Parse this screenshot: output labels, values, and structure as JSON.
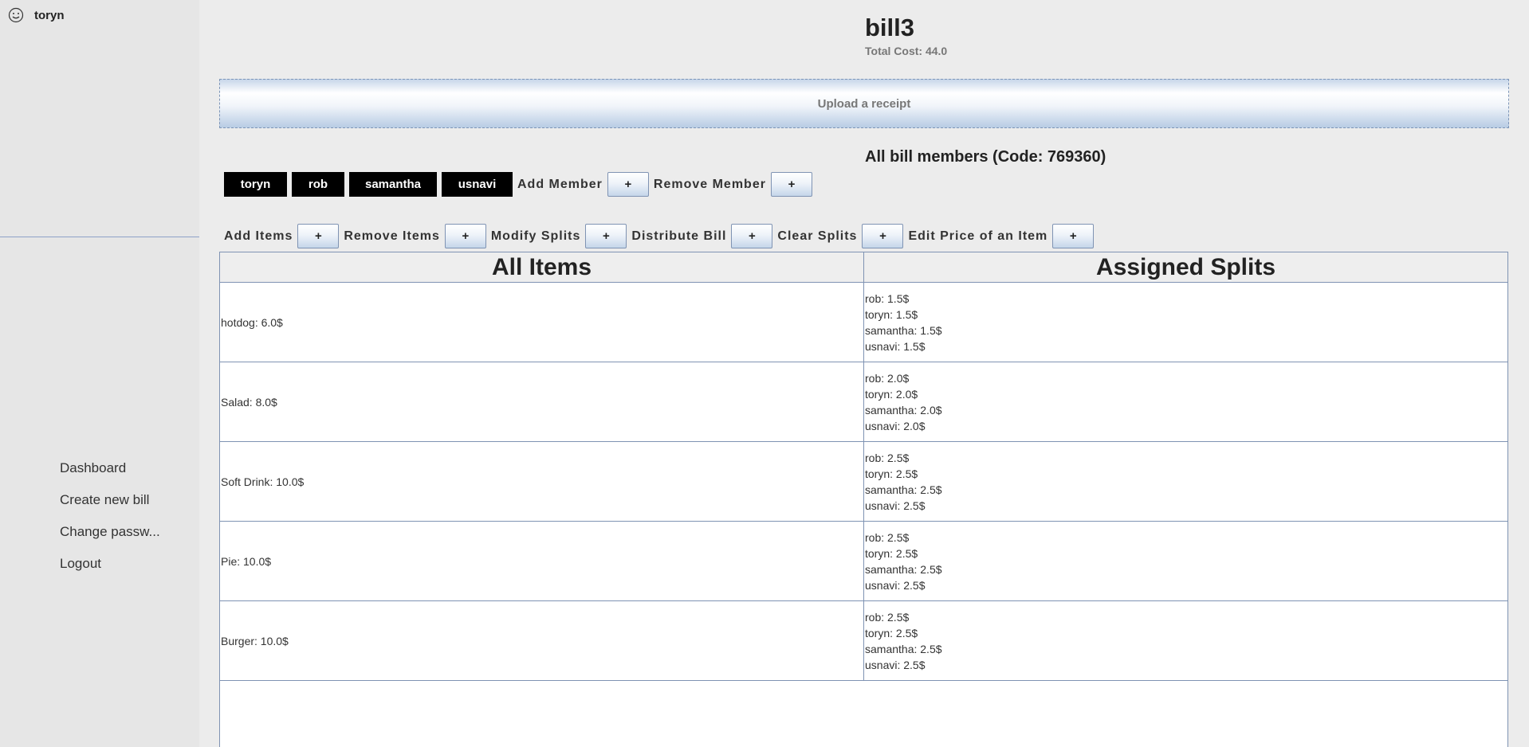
{
  "user": {
    "name": "toryn",
    "icon": "smiley-icon"
  },
  "nav": {
    "items": [
      {
        "label": "Dashboard"
      },
      {
        "label": "Create new bill"
      },
      {
        "label": "Change passw..."
      },
      {
        "label": "Logout"
      }
    ]
  },
  "bill": {
    "title": "bill3",
    "total_cost": "Total Cost: 44.0",
    "upload_label": "Upload a receipt",
    "members_title": "All bill members (Code: 769360)"
  },
  "members": [
    {
      "name": "toryn"
    },
    {
      "name": "rob"
    },
    {
      "name": "samantha"
    },
    {
      "name": "usnavi"
    }
  ],
  "member_actions": {
    "add_label": "Add Member",
    "remove_label": "Remove Member",
    "button_label": "+"
  },
  "actions": {
    "add_items": "Add Items",
    "remove_items": "Remove Items",
    "modify_splits": "Modify Splits",
    "distribute_bill": "Distribute Bill",
    "clear_splits": "Clear Splits",
    "edit_price": "Edit Price of an Item",
    "button_label": "+"
  },
  "table": {
    "headers": {
      "items": "All Items",
      "splits": "Assigned Splits"
    },
    "rows": [
      {
        "item": "hotdog: 6.0$",
        "splits": [
          "rob: 1.5$",
          "toryn: 1.5$",
          "samantha: 1.5$",
          "usnavi: 1.5$"
        ]
      },
      {
        "item": "Salad: 8.0$",
        "splits": [
          "rob: 2.0$",
          "toryn: 2.0$",
          "samantha: 2.0$",
          "usnavi: 2.0$"
        ]
      },
      {
        "item": "Soft Drink: 10.0$",
        "splits": [
          "rob: 2.5$",
          "toryn: 2.5$",
          "samantha: 2.5$",
          "usnavi: 2.5$"
        ]
      },
      {
        "item": "Pie: 10.0$",
        "splits": [
          "rob: 2.5$",
          "toryn: 2.5$",
          "samantha: 2.5$",
          "usnavi: 2.5$"
        ]
      },
      {
        "item": "Burger: 10.0$",
        "splits": [
          "rob: 2.5$",
          "toryn: 2.5$",
          "samantha: 2.5$",
          "usnavi: 2.5$"
        ]
      }
    ]
  }
}
